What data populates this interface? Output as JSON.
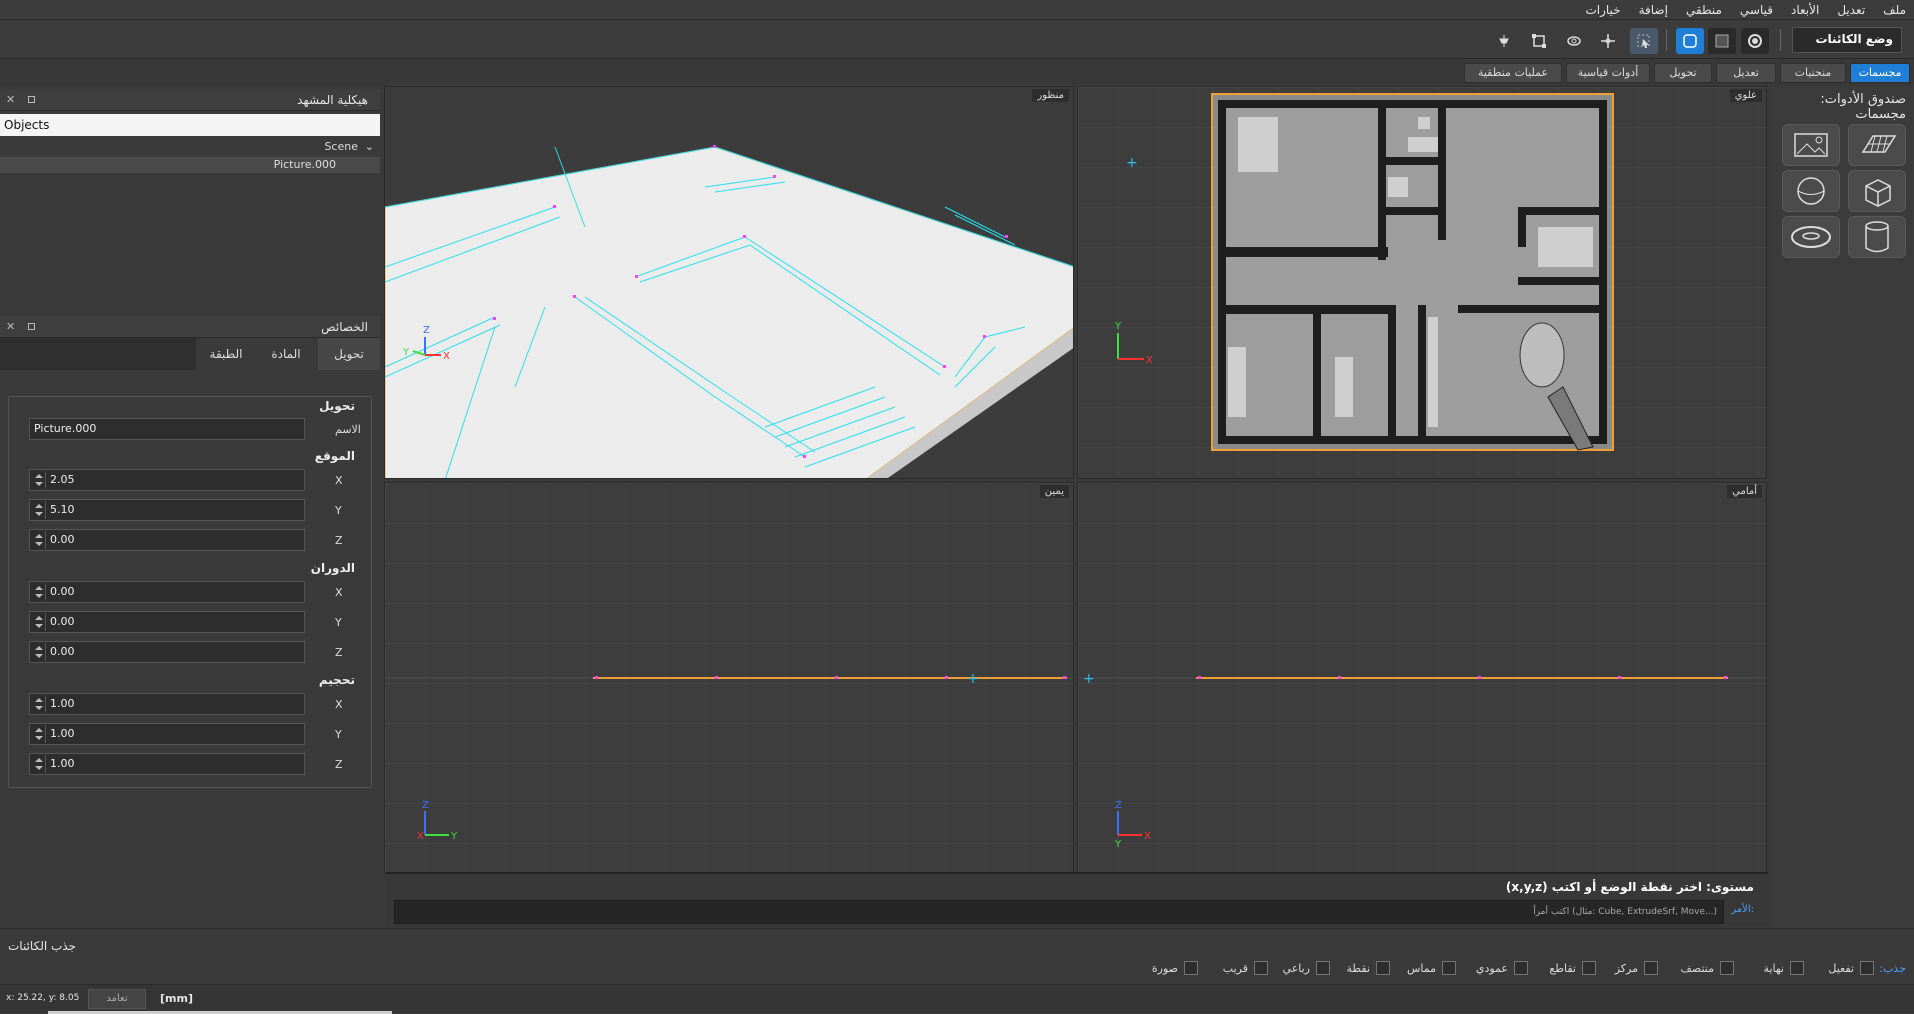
{
  "menu": [
    "ملف",
    "تعديل",
    "الأبعاد",
    "قياسي",
    "منطقي",
    "إضافة",
    "خيارات"
  ],
  "toolbar": {
    "mode_label": "وضع الكائنات",
    "icons": [
      "object-mode-icon",
      "wire-mode-icon",
      "solid-mode-icon",
      "select-tool-icon",
      "move-tool-icon",
      "rotate-tool-icon",
      "scale-tool-icon",
      "transform-tool-icon",
      "pin-icon"
    ]
  },
  "tabs": [
    "مجسمات",
    "منحنيات",
    "تعديل",
    "تحويل",
    "أدوات قياسية",
    "عمليات منطقية"
  ],
  "scene_panel": {
    "title": "هيكلية المشهد",
    "header": "Objects",
    "scene_row": "Scene",
    "object_row": "Picture.000"
  },
  "props_panel": {
    "title": "الخصائص",
    "tabs": [
      "تحويل",
      "المادة",
      "الطبقة"
    ],
    "section_transform": "تحويل",
    "name_label": "الاسم",
    "name_value": "Picture.000",
    "section_position": "الموقع",
    "section_rotation": "الدوران",
    "section_scale": "تحجيم",
    "axes": [
      "X",
      "Y",
      "Z"
    ],
    "position": [
      "2.05",
      "5.10",
      "0.00"
    ],
    "rotation": [
      "0.00",
      "0.00",
      "0.00"
    ],
    "scale": [
      "1.00",
      "1.00",
      "1.00"
    ]
  },
  "viewports": {
    "perspective": "منظور",
    "top": "علوي",
    "right": "يمين",
    "front": "أمامي"
  },
  "toolbox": {
    "title": "صندوق الأدوات: مجسمات",
    "tools": [
      "plane-icon",
      "image-icon",
      "cube-icon",
      "sphere-icon",
      "cylinder-icon",
      "torus-icon"
    ]
  },
  "command": {
    "prompt": "مستوى: اختر نقطة الوضع أو اكتب (x,y,z)",
    "label": "الأمر:",
    "placeholder": "اكتب أمراً (مثال: Cube, ExtrudeSrf, Move...)"
  },
  "snap": {
    "title": "جذب الكائنات",
    "lead": "جذب:",
    "items": [
      "تفعيل",
      "نهاية",
      "منتصف",
      "مركز",
      "تقاطع",
      "عمودي",
      "مماس",
      "نقطة",
      "رباعي",
      "قريب",
      "صورة"
    ]
  },
  "status": {
    "coords": "x: 25.22, y: 8.05",
    "ortho": "تعامد",
    "units": "[mm]"
  },
  "colors": {
    "accent": "#1f7fd6",
    "selection": "#f0a030",
    "edges": "#28e0f0"
  }
}
